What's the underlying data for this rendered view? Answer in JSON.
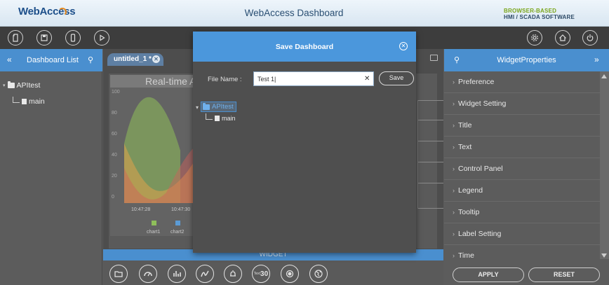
{
  "header": {
    "logo_text": "WebAccess",
    "title": "WebAccess Dashboard",
    "tagline_line1": "BROWSER-BASED",
    "tagline_line2": "HMI / SCADA SOFTWARE"
  },
  "toolbar": {
    "left_icons": [
      "import-icon",
      "save-icon",
      "mobile-icon",
      "play-icon"
    ],
    "right_icons": [
      "settings-icon",
      "home-icon",
      "power-icon"
    ]
  },
  "left_panel": {
    "title": "Dashboard List",
    "tree": {
      "root": "APItest",
      "child": "main"
    }
  },
  "center": {
    "tab_label": "untitled_1 *",
    "chart": {
      "title": "Real-time A",
      "y_ticks": [
        "100",
        "80",
        "60",
        "40",
        "20",
        "0"
      ],
      "x_ticks": [
        "10:47:28",
        "10:47:30"
      ],
      "legend": [
        {
          "name": "chart1",
          "color": "#8fbf5a"
        },
        {
          "name": "chart2",
          "color": "#5b9bd5"
        }
      ]
    },
    "widget_strip_label": "WIDGET",
    "widget_icons": [
      "folder-image-icon",
      "gauge-icon",
      "bar-chart-icon",
      "line-chart-icon",
      "alarm-icon",
      "text-number-icon",
      "button-icon",
      "globe-icon"
    ],
    "widget_text_value": "30",
    "widget_text_prefix": "Text"
  },
  "right_panel": {
    "title": "WidgetProperties",
    "items": [
      "Preference",
      "Widget Setting",
      "Title",
      "Text",
      "Control Panel",
      "Legend",
      "Tooltip",
      "Label Setting",
      "Time"
    ],
    "apply_label": "APPLY",
    "reset_label": "RESET"
  },
  "modal": {
    "title": "Save Dashboard",
    "file_name_label": "File Name :",
    "file_name_value": "Test 1|",
    "save_label": "Save",
    "tree": {
      "root": "APItest",
      "child": "main"
    }
  },
  "colors": {
    "accent_blue": "#4a8fcf",
    "modal_header": "#4b97dc",
    "chart_green": "#8fbf5a",
    "chart_red": "#d0605a",
    "chart_orange": "#e0a24a"
  }
}
